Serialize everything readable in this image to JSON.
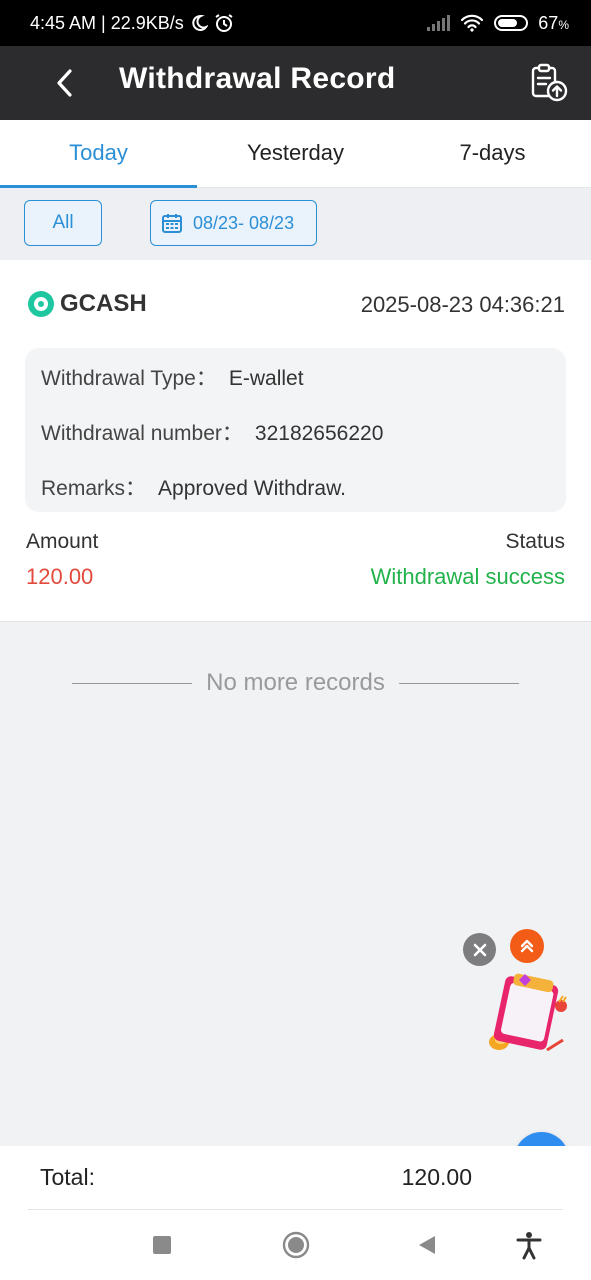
{
  "status_bar": {
    "time_speed": "4:45 AM | 22.9KB/s",
    "battery": "67",
    "battery_unit": "%"
  },
  "header": {
    "title": "Withdrawal Record"
  },
  "tabs": [
    {
      "label": "Today",
      "active": true
    },
    {
      "label": "Yesterday",
      "active": false
    },
    {
      "label": "7-days",
      "active": false
    }
  ],
  "filters": {
    "all_label": "All",
    "date_range": "08/23- 08/23"
  },
  "record": {
    "provider": "GCASH",
    "datetime": "2025-08-23 04:36:21",
    "withdrawal_type_label": "Withdrawal Type：",
    "withdrawal_type_value": "E-wallet",
    "withdrawal_number_label": "Withdrawal number：",
    "withdrawal_number_value": "32182656220",
    "remarks_label": "Remarks：",
    "remarks_value": "Approved Withdraw.",
    "amount_label": "Amount",
    "amount_value": "120.00",
    "status_label": "Status",
    "status_value": "Withdrawal success"
  },
  "no_more": "No more records",
  "total": {
    "label": "Total:",
    "value": "120.00"
  },
  "colors": {
    "accent": "#2b8fd6",
    "amount": "#e24a3b",
    "success": "#22b24c",
    "header_bg": "#2c2c2e"
  }
}
